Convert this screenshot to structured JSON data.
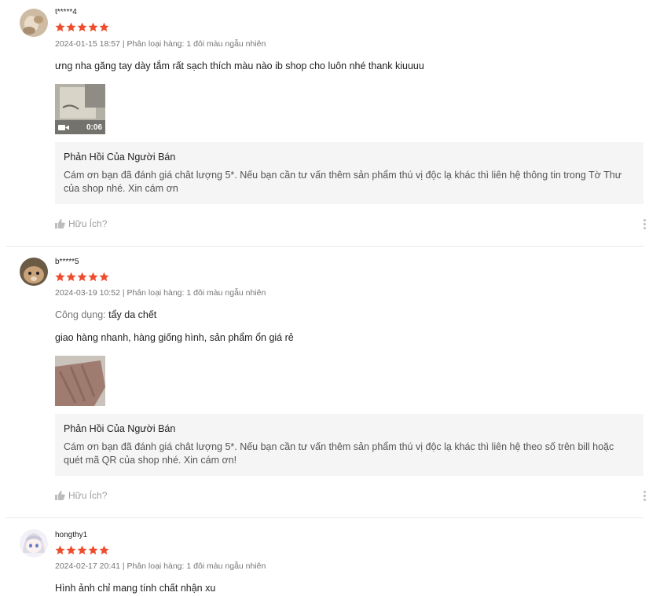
{
  "accent_star_color": "#ee4d2d",
  "reviews": [
    {
      "username": "t*****4",
      "rating": 5,
      "meta": "2024-01-15 18:57 | Phân loại hàng: 1 đôi màu ngẫu nhiên",
      "text": "ưng nha găng tay dày tắm rất sạch thích màu nào ib shop cho luôn nhé thank kiuuuu",
      "video_duration": "0:06",
      "reply_title": "Phản Hồi Của Người Bán",
      "reply_text": "Cám ơn bạn đã đánh giá chât lượng 5*. Nếu bạn cần tư vấn thêm sản phẩm thú vị độc lạ khác thì liên hệ thông tin trong Tờ Thư của shop nhé. Xin cám ơn",
      "helpful_label": "Hữu Ích?"
    },
    {
      "username": "b*****5",
      "rating": 5,
      "meta": "2024-03-19 10:52 | Phân loại hàng: 1 đôi màu ngẫu nhiên",
      "attr_label": "Công dụng:",
      "attr_value": "tẩy da chết",
      "text": "giao hàng nhanh, hàng giống hình, sản phẩm ổn giá rẻ",
      "reply_title": "Phản Hồi Của Người Bán",
      "reply_text": "Cám ơn bạn đã đánh giá chât lượng 5*. Nếu bạn cần tư vấn thêm sản phẩm thú vị độc lạ khác thì liên hệ theo số trên bill hoặc quét mã QR của shop nhé. Xin cám ơn!",
      "helpful_label": "Hữu Ích?"
    },
    {
      "username": "hongthy1",
      "rating": 5,
      "meta": "2024-02-17 20:41 | Phân loại hàng: 1 đôi màu ngẫu nhiên",
      "text": "Hình ảnh chỉ mang tính chất nhận xu"
    }
  ]
}
